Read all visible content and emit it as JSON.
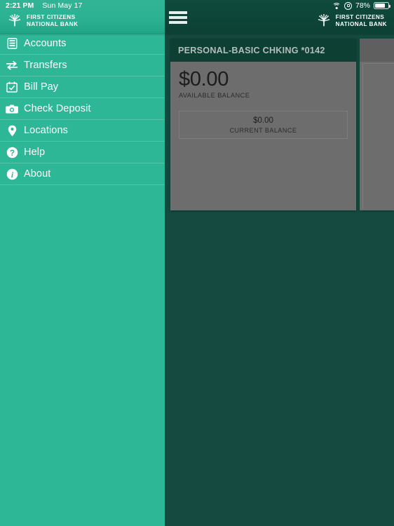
{
  "status_bar": {
    "time": "2:21 PM",
    "date": "Sun May 17",
    "wifi_icon": "wifi-icon",
    "rotation_lock_icon": "rotation-lock-icon",
    "battery_percent": "78%",
    "battery_icon": "battery-icon"
  },
  "brand": {
    "logo_icon": "first-citizens-tree-logo",
    "name_line1": "FIRST CITIZENS",
    "name_line2": "NATIONAL BANK"
  },
  "header": {
    "menu_icon": "hamburger-menu-icon"
  },
  "sidebar": {
    "items": [
      {
        "label": "Accounts",
        "icon": "accounts-icon"
      },
      {
        "label": "Transfers",
        "icon": "transfers-icon"
      },
      {
        "label": "Bill Pay",
        "icon": "bill-pay-calendar-icon"
      },
      {
        "label": "Check Deposit",
        "icon": "camera-icon"
      },
      {
        "label": "Locations",
        "icon": "map-pin-icon"
      },
      {
        "label": "Help",
        "icon": "question-circle-icon"
      },
      {
        "label": "About",
        "icon": "info-circle-icon"
      }
    ]
  },
  "accounts": [
    {
      "title": "PERSONAL-BASIC CHKING *0142",
      "available_amount": "$0.00",
      "available_label": "AVAILABLE BALANCE",
      "current_amount": "$0.00",
      "current_label": "CURRENT BALANCE"
    }
  ],
  "colors": {
    "sidebar_green": "#2eb796",
    "app_dark_green": "#144a3f",
    "header_dark_green": "#0d3f33",
    "card_gray": "#6d6d6d"
  }
}
